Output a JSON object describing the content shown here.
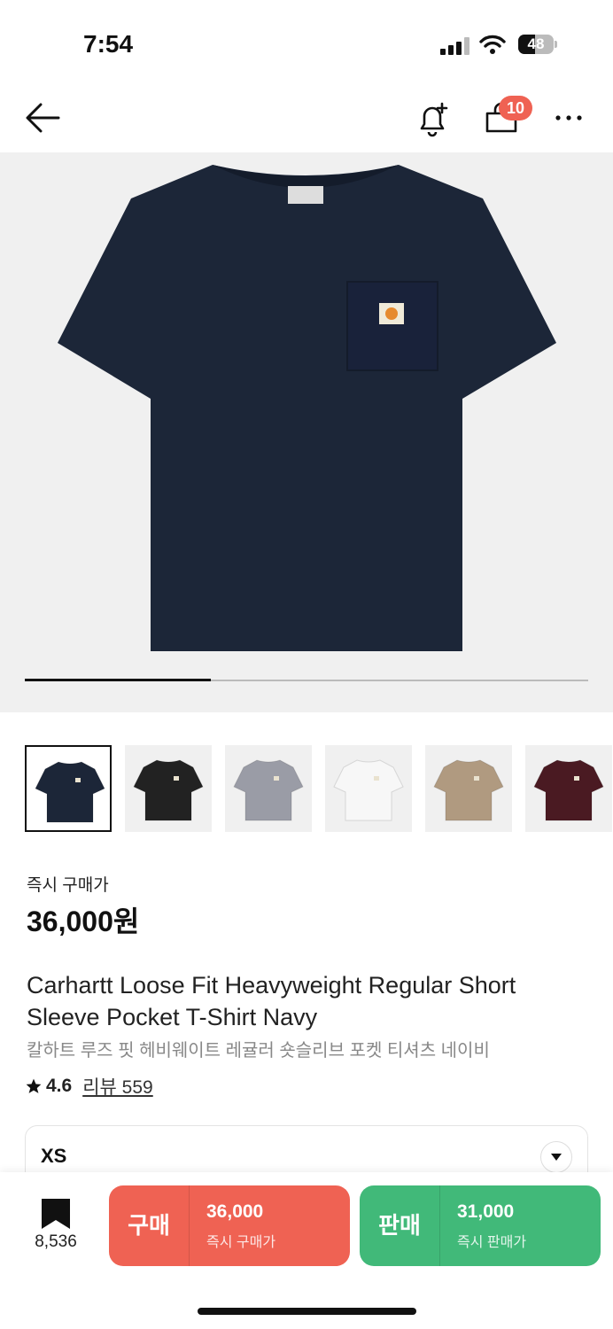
{
  "status_bar": {
    "time": "7:54",
    "battery": "48",
    "battery_level": 0.48
  },
  "nav": {
    "back_icon": "arrow-left-icon",
    "bell_icon": "bell-plus-icon",
    "cart_icon": "shopping-bag-icon",
    "cart_count": "10",
    "more_icon": "more-dots-icon"
  },
  "gallery": {
    "progress": 0.33,
    "shirt_color": "#1c2638"
  },
  "thumbnails": [
    {
      "color": "#1c2638",
      "selected": true
    },
    {
      "color": "#222222",
      "selected": false
    },
    {
      "color": "#9a9ca6",
      "selected": false
    },
    {
      "color": "#f7f7f7",
      "selected": false
    },
    {
      "color": "#b09a80",
      "selected": false
    },
    {
      "color": "#4a1a22",
      "selected": false
    }
  ],
  "product": {
    "price_label": "즉시 구매가",
    "price": "36,000원",
    "title_en": "Carhartt Loose Fit Heavyweight Regular Short Sleeve Pocket T-Shirt Navy",
    "title_ko": "칼하트 루즈 핏 헤비웨이트 레귤러 숏슬리브 포켓 티셔츠 네이비",
    "rating": "4.6",
    "review_label": "리뷰 559"
  },
  "size": {
    "selected": "XS"
  },
  "bottom": {
    "bookmark_count": "8,536",
    "buy": {
      "label": "구매",
      "price": "36,000",
      "sub": "즉시 구매가",
      "color": "#ef6253"
    },
    "sell": {
      "label": "판매",
      "price": "31,000",
      "sub": "즉시 판매가",
      "color": "#41b979"
    }
  }
}
